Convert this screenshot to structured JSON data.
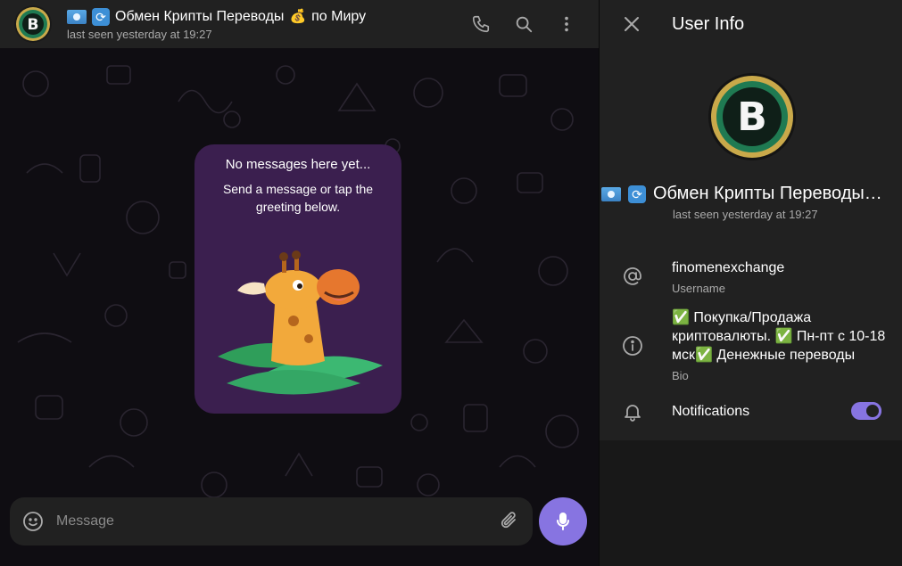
{
  "chat": {
    "title": "Обмен Крипты Переводы",
    "title_suffix": "по Миру",
    "title_emoji_bag": "💰",
    "cycle_glyph": "⟳",
    "status": "last seen yesterday at 19:27",
    "header_icons": [
      "phone-icon",
      "search-icon",
      "more-vertical-icon"
    ],
    "empty": {
      "title": "No messages here yet...",
      "subtitle": "Send a message or tap the greeting below."
    },
    "composer": {
      "placeholder": "Message"
    }
  },
  "info": {
    "title": "User Info",
    "name": "Обмен Крипты Переводы…",
    "status": "last seen yesterday at 19:27",
    "username": "finomenexchange",
    "username_label": "Username",
    "bio": "✅  Покупка/Продажа криптовалюты. ✅ Пн-пт с 10-18 мск✅  Денежные переводы",
    "bio_label": "Bio",
    "notifications_label": "Notifications",
    "notifications_on": true
  },
  "colors": {
    "accent": "#8774e1",
    "panel": "#212121",
    "background": "#181818",
    "empty_card": "#3b1f4f",
    "secondary_text": "#aaaaaa"
  }
}
